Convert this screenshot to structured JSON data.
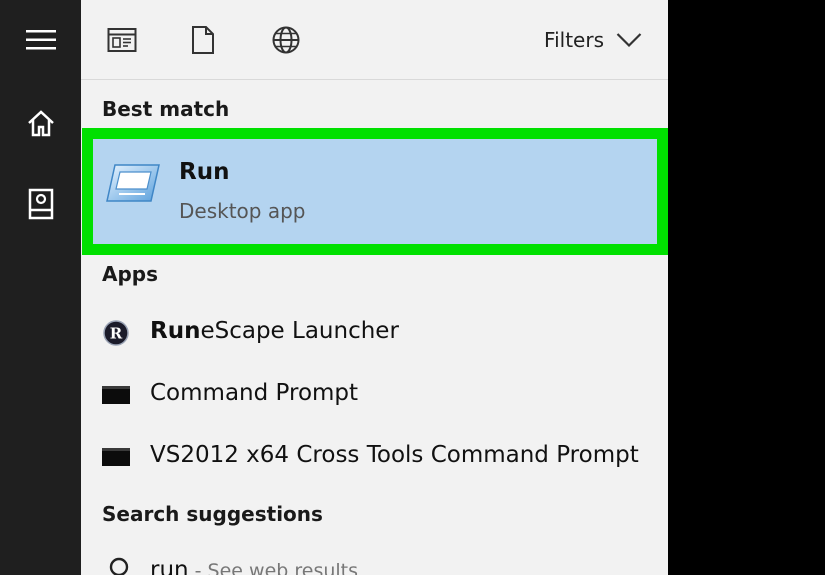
{
  "toolbar": {
    "filters_label": "Filters"
  },
  "best_match": {
    "heading": "Best match",
    "title": "Run",
    "subtitle": "Desktop app"
  },
  "apps": {
    "heading": "Apps",
    "items": [
      {
        "bold": "Run",
        "rest": "eScape Launcher"
      },
      {
        "bold": "",
        "rest": "Command Prompt"
      },
      {
        "bold": "",
        "rest": "VS2012 x64 Cross Tools Command Prompt"
      }
    ]
  },
  "suggestions": {
    "heading": "Search suggestions",
    "query": "run",
    "hint": " - See web results"
  },
  "colors": {
    "highlight_border": "#00e000",
    "highlight_fill": "#b4d4f0",
    "rail": "#1f1f1f",
    "panel": "#f2f2f2"
  },
  "icons": {
    "rail": [
      "hamburger-menu-icon",
      "home-icon",
      "notebook-icon"
    ],
    "toolbar": [
      "apps-filter-icon",
      "documents-filter-icon",
      "web-filter-icon",
      "chevron-down-icon"
    ]
  }
}
